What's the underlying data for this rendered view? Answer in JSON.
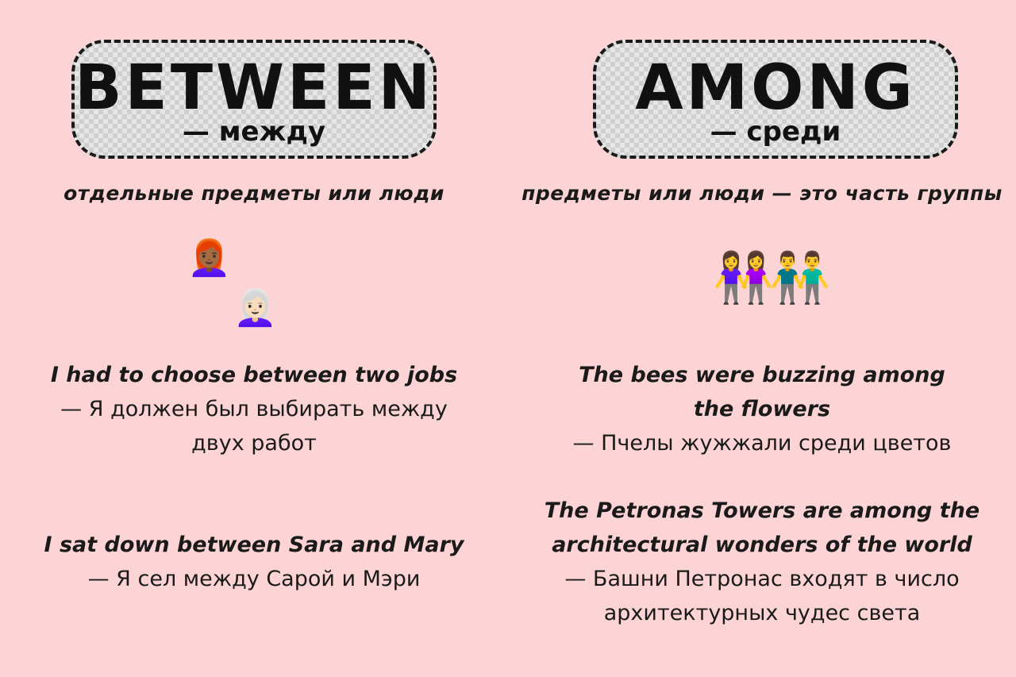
{
  "left": {
    "word": "BETWEEN",
    "translation": "— между",
    "subtitle": "отдельные предметы или люди",
    "emoji_1": "👩🏾‍🦰",
    "emoji_2": "👩🏻‍🦳",
    "examples": [
      {
        "en": "I had to choose between two jobs",
        "ru": "— Я должен был выбирать между двух работ"
      },
      {
        "en": "I sat down between Sara and Mary",
        "ru": "— Я сел между Сарой и Мэри"
      }
    ]
  },
  "right": {
    "word": "AMONG",
    "translation": "— среди",
    "subtitle": "предметы или люди — это часть группы",
    "emoji": "👭👬",
    "examples": [
      {
        "en": "The bees were buzzing among the flowers",
        "ru": "— Пчелы жужжали среди цветов"
      },
      {
        "en": "The Petronas Towers are among the architectural wonders of the world",
        "ru": "— Башни Петронас входят в число архитектурных чудес света"
      }
    ]
  }
}
